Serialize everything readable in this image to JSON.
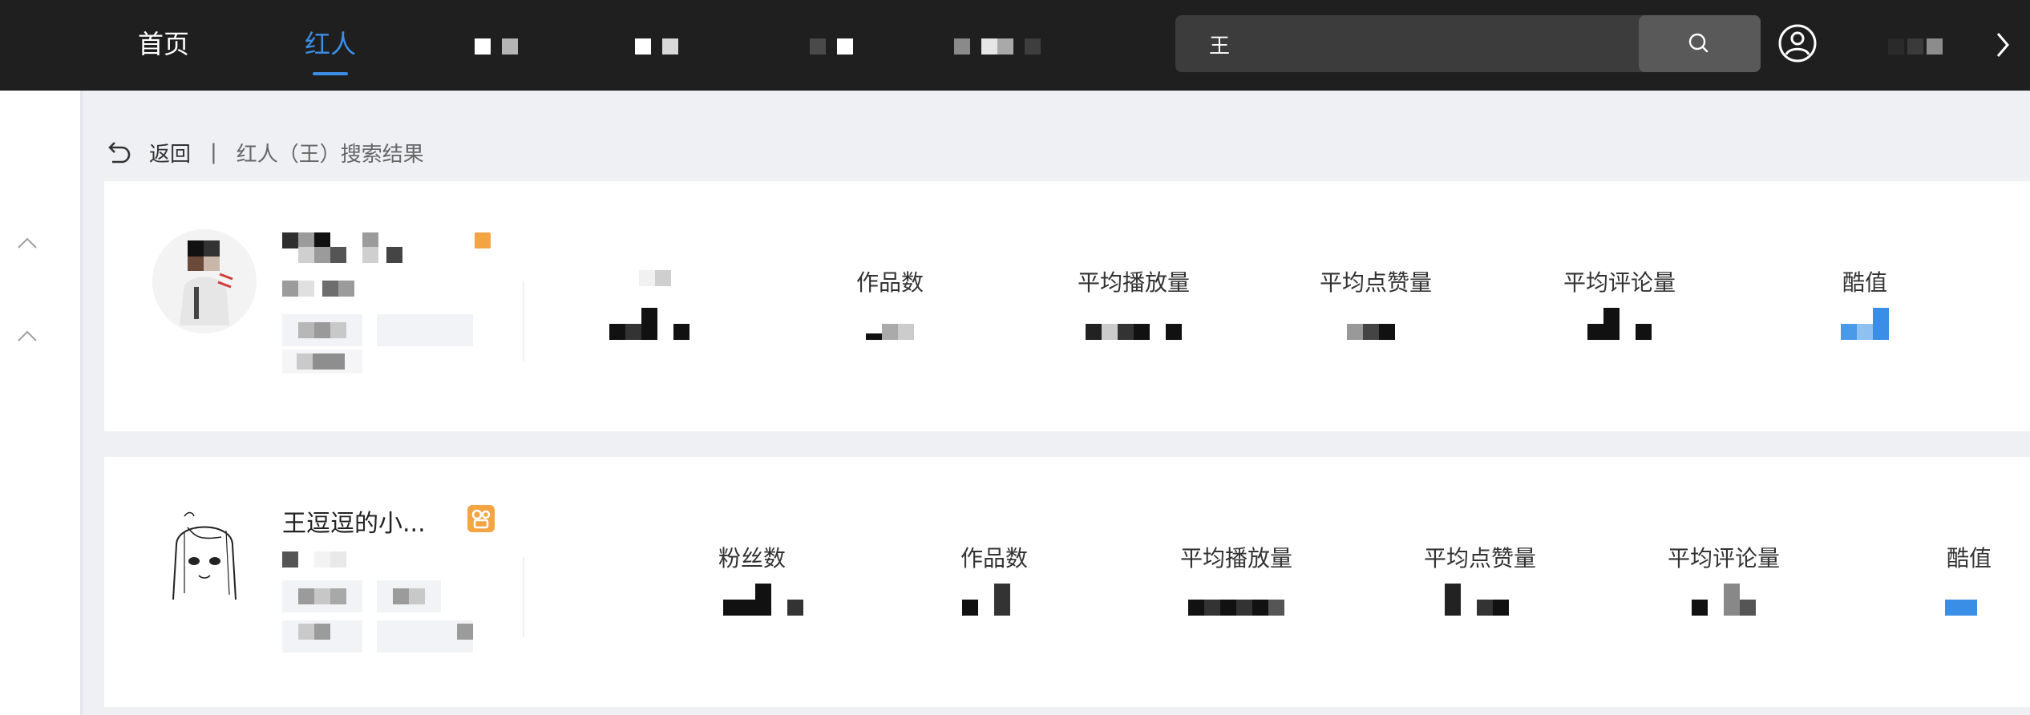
{
  "nav": {
    "home": "首页",
    "influencers": "红人"
  },
  "search": {
    "value": "王",
    "placeholder": ""
  },
  "breadcrumb": {
    "back": "返回",
    "separator": "|",
    "title": "红人（王）搜索结果"
  },
  "results": [
    {
      "name": "",
      "stats": {
        "fans_label": "",
        "works_label": "作品数",
        "avg_plays_label": "平均播放量",
        "avg_likes_label": "平均点赞量",
        "avg_comments_label": "平均评论量",
        "score_label": "酷值"
      }
    },
    {
      "name": "王逗逗的小...",
      "stats": {
        "fans_label": "粉丝数",
        "works_label": "作品数",
        "avg_plays_label": "平均播放量",
        "avg_likes_label": "平均点赞量",
        "avg_comments_label": "平均评论量",
        "score_label": "酷值"
      }
    }
  ],
  "colors": {
    "accent": "#3a8ee6",
    "topbar": "#1f1f1f",
    "badge": "#f3a443",
    "score": "#4a9ae8"
  },
  "icons": {
    "search": "search-icon",
    "user": "user-circle-icon",
    "back": "back-arrow-icon",
    "chevron_up": "chevron-up-icon",
    "chevron_right": "chevron-right-icon"
  }
}
